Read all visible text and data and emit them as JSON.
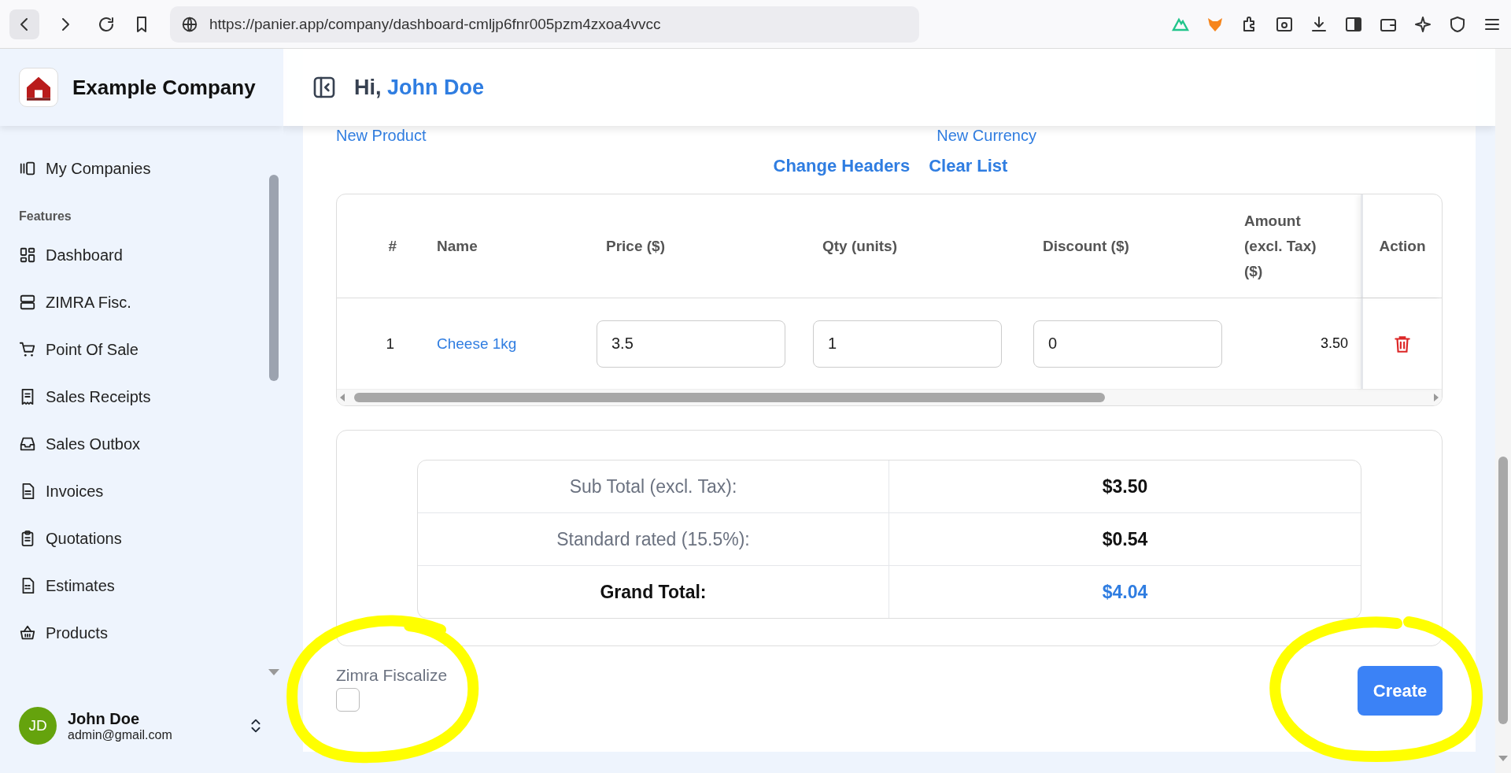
{
  "browser": {
    "url": "https://panier.app/company/dashboard-cmljp6fnr005pzm4zxoa4vvcc"
  },
  "sidebar": {
    "company": "Example Company",
    "top_item": "My Companies",
    "section": "Features",
    "items": [
      {
        "label": "Dashboard"
      },
      {
        "label": "ZIMRA Fisc."
      },
      {
        "label": "Point Of Sale"
      },
      {
        "label": "Sales Receipts"
      },
      {
        "label": "Sales Outbox"
      },
      {
        "label": "Invoices"
      },
      {
        "label": "Quotations"
      },
      {
        "label": "Estimates"
      },
      {
        "label": "Products"
      }
    ],
    "user": {
      "initials": "JD",
      "name": "John Doe",
      "email": "admin@gmail.com"
    }
  },
  "header": {
    "greeting": "Hi,",
    "user_name": "John Doe"
  },
  "links": [
    "New Product",
    "New Currency"
  ],
  "actions": [
    "Change Headers",
    "Clear List"
  ],
  "table": {
    "columns": [
      "#",
      "Name",
      "Price ($)",
      "Qty (units)",
      "Discount ($)",
      "Amount (excl. Tax) ($)",
      "Action"
    ],
    "rows": [
      {
        "number": "1",
        "name": "Cheese 1kg",
        "price": "3.5",
        "qty": "1",
        "discount": "0",
        "amount": "3.50"
      }
    ]
  },
  "totals": [
    {
      "label": "Sub Total (excl. Tax):",
      "value": "$3.50",
      "kind": "plain"
    },
    {
      "label": "Standard rated (15.5%):",
      "value": "$0.54",
      "kind": "plain"
    },
    {
      "label": "Grand Total:",
      "value": "$4.04",
      "kind": "grand"
    }
  ],
  "fiscalize": {
    "label": "Zimra Fiscalize",
    "checked": false
  },
  "create_button": "Create",
  "markup_circles": [
    {
      "color": "#ffff00"
    },
    {
      "color": "#ffff00"
    }
  ]
}
